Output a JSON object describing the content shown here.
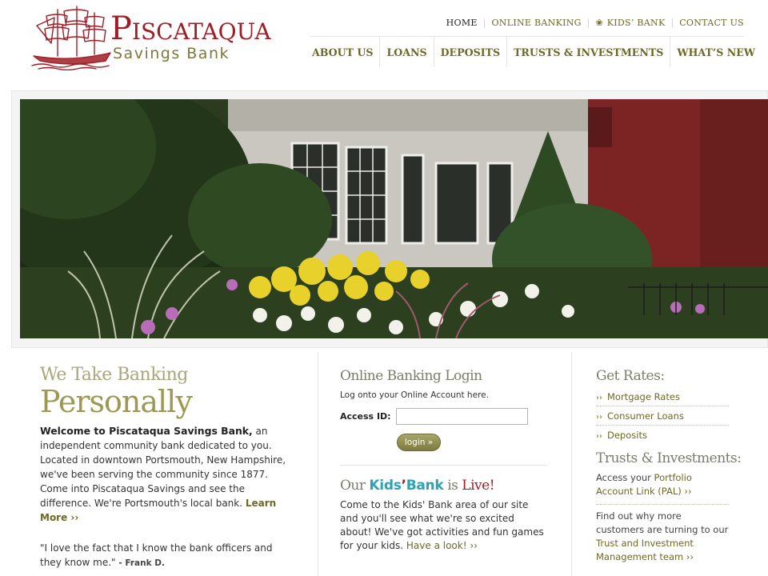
{
  "brand": {
    "name": "Piscataqua",
    "subtitle": "Savings Bank",
    "primary_color": "#a01d25",
    "accent_color": "#6b6a24"
  },
  "utility_nav": [
    {
      "label": "HOME",
      "active": true
    },
    {
      "label": "ONLINE BANKING",
      "active": false
    },
    {
      "label": "KIDS’ BANK",
      "active": false,
      "icon": "paw-icon"
    },
    {
      "label": "CONTACT US",
      "active": false
    }
  ],
  "main_nav": [
    {
      "label": "ABOUT US"
    },
    {
      "label": "LOANS"
    },
    {
      "label": "DEPOSITS"
    },
    {
      "label": "TRUSTS & INVESTMENTS"
    },
    {
      "label": "WHAT’S NEW"
    }
  ],
  "welcome": {
    "tagline_line1": "We Take Banking",
    "tagline_line2": "Personally",
    "lead": "Welcome to Piscataqua Savings Bank,",
    "body": " an independent community bank dedicated to you. Located in downtown Portsmouth, New Hampshire, we've been serving the community since 1877. Come into Piscataqua Savings and see the difference. We're Portsmouth's local bank. ",
    "learn_more": "Learn More ››",
    "quote": "\"I love the fact that I know the bank officers and they know me.\" ",
    "quote_author": "- Frank D."
  },
  "login": {
    "title": "Online Banking Login",
    "subtitle": "Log onto your Online Account here.",
    "access_label": "Access ID:",
    "access_value": "",
    "access_placeholder": "",
    "button": "login »"
  },
  "kids": {
    "prefix": "Our ",
    "kids_word": "Kids",
    "apostrophe": "’",
    "bank_word": "Bank",
    "is_word": " is ",
    "live_word": "Live!",
    "body": "Come to the Kids' Bank area of our site and you'll see what we're so excited about! We've got activities and fun games for your kids. ",
    "link": "Have a look! ››"
  },
  "rates": {
    "title": "Get Rates:",
    "bullet": "››",
    "items": [
      "Mortgage Rates",
      "Consumer Loans",
      "Deposits"
    ]
  },
  "trusts": {
    "title": "Trusts & Investments:",
    "pal_text": "Access your ",
    "pal_link": "Portfolio Account Link (PAL) ››",
    "more_text": "Find out why more customers are turning to our ",
    "more_link": "Trust and Investment Management team ››"
  }
}
